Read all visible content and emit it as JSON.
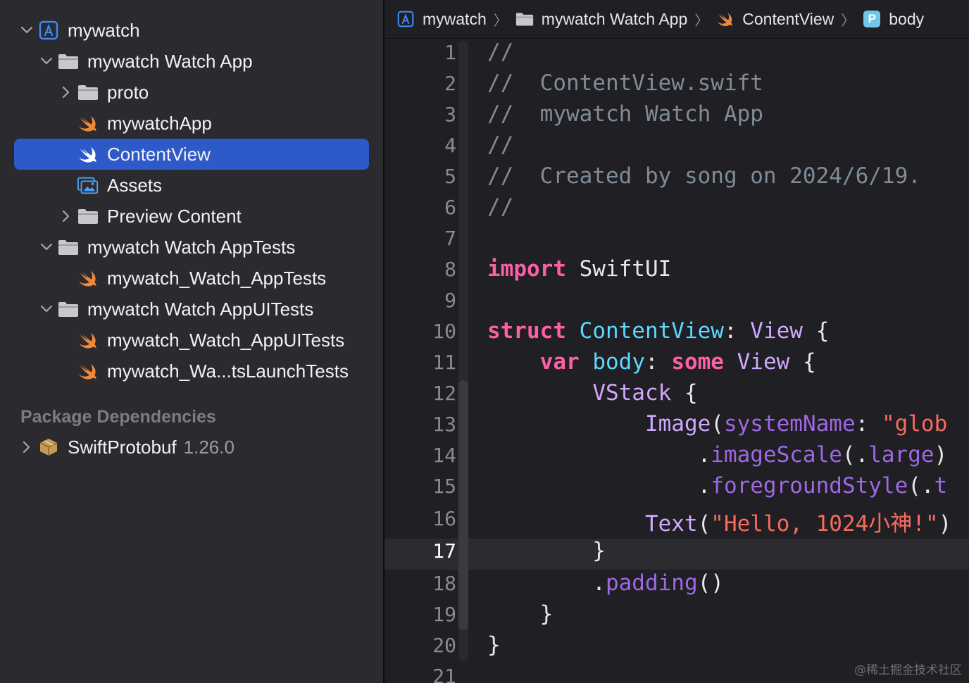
{
  "sidebar": {
    "items": [
      {
        "label": "mywatch",
        "icon": "xcode-project-icon",
        "expanded": true
      },
      {
        "label": "mywatch Watch App",
        "icon": "folder-icon",
        "expanded": true
      },
      {
        "label": "proto",
        "icon": "folder-icon",
        "expanded": false
      },
      {
        "label": "mywatchApp",
        "icon": "swift-file-icon"
      },
      {
        "label": "ContentView",
        "icon": "swift-file-icon",
        "selected": true
      },
      {
        "label": "Assets",
        "icon": "asset-catalog-icon"
      },
      {
        "label": "Preview Content",
        "icon": "folder-icon",
        "expanded": false
      },
      {
        "label": "mywatch Watch AppTests",
        "icon": "folder-icon",
        "expanded": true
      },
      {
        "label": "mywatch_Watch_AppTests",
        "icon": "swift-file-icon"
      },
      {
        "label": "mywatch Watch AppUITests",
        "icon": "folder-icon",
        "expanded": true
      },
      {
        "label": "mywatch_Watch_AppUITests",
        "icon": "swift-file-icon"
      },
      {
        "label": "mywatch_Wa...tsLaunchTests",
        "icon": "swift-file-icon"
      }
    ],
    "package_header": "Package Dependencies",
    "package": {
      "name": "SwiftProtobuf",
      "version": "1.26.0",
      "icon": "package-icon"
    }
  },
  "breadcrumb": [
    {
      "label": "mywatch",
      "icon": "xcode-project-icon"
    },
    {
      "label": "mywatch Watch App",
      "icon": "folder-icon"
    },
    {
      "label": "ContentView",
      "icon": "swift-file-icon"
    },
    {
      "label": "body",
      "icon": "property-icon",
      "icon_letter": "P"
    }
  ],
  "breadcrumb_separator": "〉",
  "editor": {
    "current_line": 17,
    "line_numbers": [
      "1",
      "2",
      "3",
      "4",
      "5",
      "6",
      "7",
      "8",
      "9",
      "10",
      "11",
      "12",
      "13",
      "14",
      "15",
      "16",
      "17",
      "18",
      "19",
      "20",
      "21"
    ],
    "lines": [
      [
        {
          "t": "//",
          "c": "comment"
        }
      ],
      [
        {
          "t": "//  ContentView.swift",
          "c": "comment"
        }
      ],
      [
        {
          "t": "//  mywatch Watch App",
          "c": "comment"
        }
      ],
      [
        {
          "t": "//",
          "c": "comment"
        }
      ],
      [
        {
          "t": "//  Created by song on 2024/6/19.",
          "c": "comment"
        }
      ],
      [
        {
          "t": "//",
          "c": "comment"
        }
      ],
      [],
      [
        {
          "t": "import",
          "c": "keyword"
        },
        {
          "t": " SwiftUI",
          "c": "plain"
        }
      ],
      [],
      [
        {
          "t": "struct",
          "c": "keyword"
        },
        {
          "t": " ",
          "c": "plain"
        },
        {
          "t": "ContentView",
          "c": "typedecl"
        },
        {
          "t": ": ",
          "c": "plain"
        },
        {
          "t": "View",
          "c": "type"
        },
        {
          "t": " {",
          "c": "plain"
        }
      ],
      [
        {
          "t": "    ",
          "c": "plain"
        },
        {
          "t": "var",
          "c": "keyword"
        },
        {
          "t": " ",
          "c": "plain"
        },
        {
          "t": "body",
          "c": "typedecl"
        },
        {
          "t": ": ",
          "c": "plain"
        },
        {
          "t": "some",
          "c": "keyword"
        },
        {
          "t": " ",
          "c": "plain"
        },
        {
          "t": "View",
          "c": "type"
        },
        {
          "t": " {",
          "c": "plain"
        }
      ],
      [
        {
          "t": "        ",
          "c": "plain"
        },
        {
          "t": "VStack",
          "c": "type"
        },
        {
          "t": " {",
          "c": "plain"
        }
      ],
      [
        {
          "t": "            ",
          "c": "plain"
        },
        {
          "t": "Image",
          "c": "type"
        },
        {
          "t": "(",
          "c": "plain"
        },
        {
          "t": "systemName",
          "c": "method"
        },
        {
          "t": ": ",
          "c": "plain"
        },
        {
          "t": "\"glob",
          "c": "string"
        }
      ],
      [
        {
          "t": "                .",
          "c": "plain"
        },
        {
          "t": "imageScale",
          "c": "method"
        },
        {
          "t": "(.",
          "c": "plain"
        },
        {
          "t": "large",
          "c": "method"
        },
        {
          "t": ")",
          "c": "plain"
        }
      ],
      [
        {
          "t": "                .",
          "c": "plain"
        },
        {
          "t": "foregroundStyle",
          "c": "method"
        },
        {
          "t": "(.",
          "c": "plain"
        },
        {
          "t": "t",
          "c": "method"
        }
      ],
      [
        {
          "t": "            ",
          "c": "plain"
        },
        {
          "t": "Text",
          "c": "type"
        },
        {
          "t": "(",
          "c": "plain"
        },
        {
          "t": "\"Hello, 1024小神!\"",
          "c": "string"
        },
        {
          "t": ")",
          "c": "plain"
        }
      ],
      [
        {
          "t": "        }",
          "c": "plain"
        }
      ],
      [
        {
          "t": "        .",
          "c": "plain"
        },
        {
          "t": "padding",
          "c": "method"
        },
        {
          "t": "()",
          "c": "plain"
        }
      ],
      [
        {
          "t": "    }",
          "c": "plain"
        }
      ],
      [
        {
          "t": "}",
          "c": "plain"
        }
      ],
      []
    ]
  },
  "watermark": "@稀土掘金技术社区",
  "colors": {
    "selection": "#2e59c9",
    "swift_orange": "#f0883a",
    "folder": "#c8c8cc",
    "project_blue": "#3d8af7"
  }
}
